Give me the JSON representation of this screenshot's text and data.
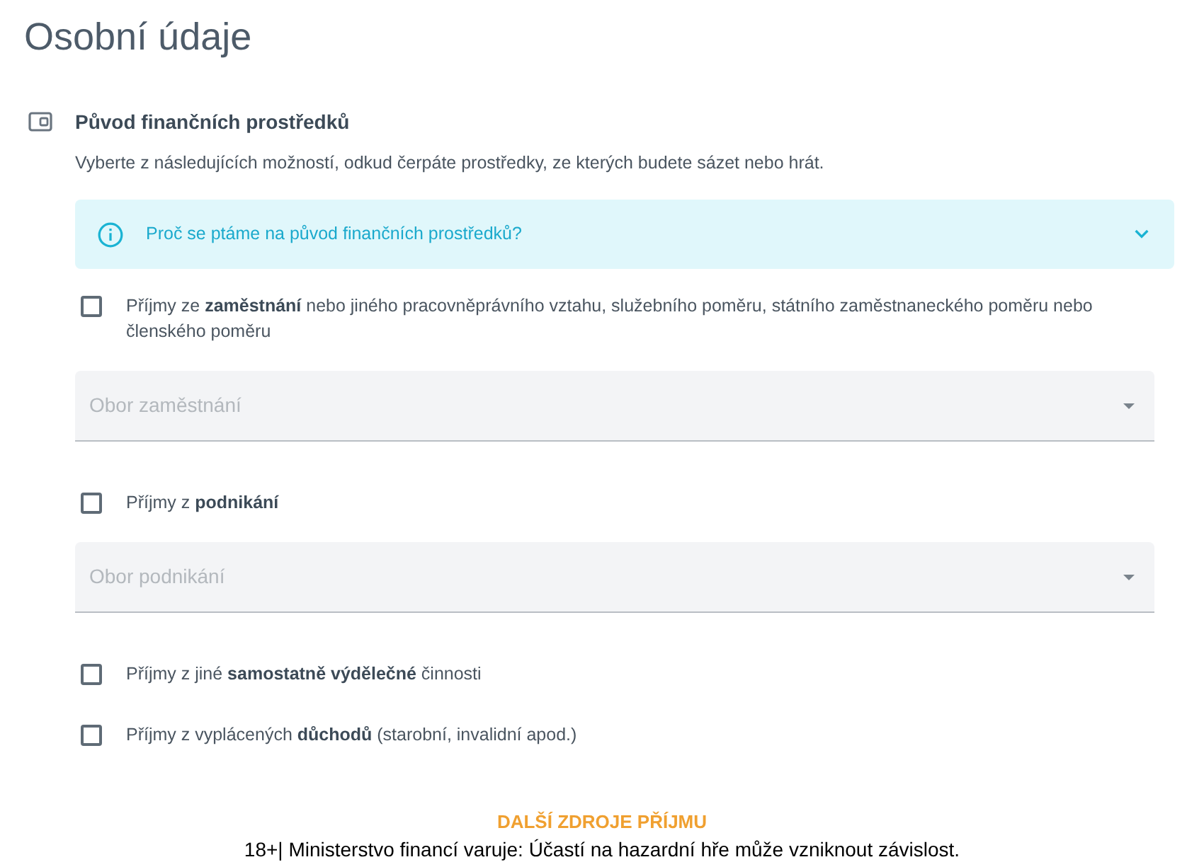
{
  "page": {
    "title": "Osobní údaje"
  },
  "section": {
    "title": "Původ finančních prostředků",
    "description": "Vyberte z následujících možností, odkud čerpáte prostředky, ze kterých budete sázet nebo hrát.",
    "info": {
      "text": "Proč se ptáme na původ finančních prostředků?",
      "expanded": false
    },
    "items": [
      {
        "kind": "checkbox",
        "label": "Příjmy ze **zaměstnání** nebo jiného pracovněprávního vztahu, služebního poměru, státního zaměstnaneckého poměru nebo členského poměru",
        "checked": false
      },
      {
        "kind": "select",
        "placeholder": "Obor zaměstnání"
      },
      {
        "kind": "checkbox",
        "label": "Příjmy z **podnikání**",
        "checked": false
      },
      {
        "kind": "select",
        "placeholder": "Obor podnikání"
      },
      {
        "kind": "checkbox",
        "label": "Příjmy z jiné **samostatně výdělečné** činnosti",
        "checked": false
      },
      {
        "kind": "checkbox",
        "label": "Příjmy z vyplácených **důchodů** (starobní, invalidní apod.)",
        "checked": false
      }
    ]
  },
  "more_button": "DALŠÍ ZDROJE PŘÍJMU",
  "warning_bar": "18+| Ministerstvo financí varuje: Účastí na hazardní hře může vzniknout závislost."
}
